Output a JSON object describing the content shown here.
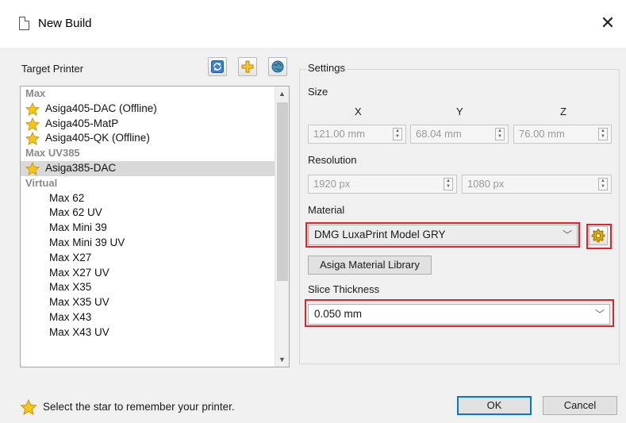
{
  "window": {
    "title": "New Build",
    "close_glyph": "✕"
  },
  "left": {
    "target_printer_label": "Target Printer",
    "toolbar": [
      {
        "name": "refresh-icon"
      },
      {
        "name": "add-icon"
      },
      {
        "name": "globe-icon"
      }
    ],
    "groups": [
      {
        "header": "Max",
        "items": [
          {
            "label": "Asiga405-DAC (Offline)",
            "star": true
          },
          {
            "label": "Asiga405-MatP",
            "star": true
          },
          {
            "label": "Asiga405-QK (Offline)",
            "star": true
          }
        ]
      },
      {
        "header": "Max UV385",
        "items": [
          {
            "label": "Asiga385-DAC",
            "star": true,
            "selected": true
          }
        ]
      },
      {
        "header": "Virtual",
        "items": [
          {
            "label": "Max 62"
          },
          {
            "label": "Max 62 UV"
          },
          {
            "label": "Max Mini 39"
          },
          {
            "label": "Max Mini 39 UV"
          },
          {
            "label": "Max X27"
          },
          {
            "label": "Max X27 UV"
          },
          {
            "label": "Max X35"
          },
          {
            "label": "Max X35 UV"
          },
          {
            "label": "Max X43"
          },
          {
            "label": "Max X43 UV"
          }
        ]
      }
    ],
    "footer_hint": "Select the star to remember your printer."
  },
  "settings": {
    "legend": "Settings",
    "size_label": "Size",
    "axis": {
      "x": "X",
      "y": "Y",
      "z": "Z"
    },
    "size": {
      "x": "121.00 mm",
      "y": "68.04 mm",
      "z": "76.00 mm"
    },
    "resolution_label": "Resolution",
    "resolution": {
      "w": "1920 px",
      "h": "1080 px"
    },
    "material_label": "Material",
    "material_value": "DMG LuxaPrint Model GRY",
    "material_library_button": "Asiga Material Library",
    "slice_label": "Slice Thickness",
    "slice_value": "0.050 mm"
  },
  "buttons": {
    "ok": "OK",
    "cancel": "Cancel"
  },
  "colors": {
    "highlight": "#e0232c",
    "selection": "#d9d9d9",
    "star": "#f5c518",
    "primary_border": "#0078d7"
  }
}
